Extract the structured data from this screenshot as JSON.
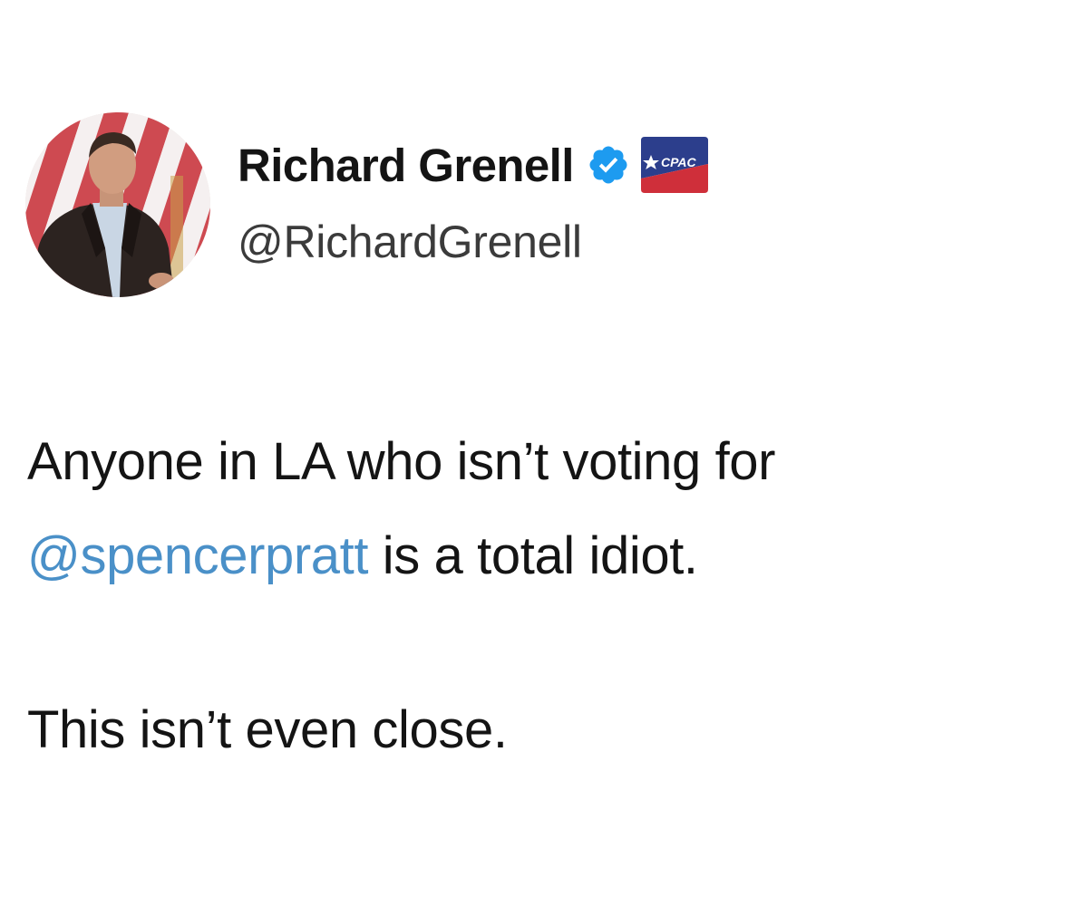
{
  "author": {
    "display_name": "Richard Grenell",
    "handle": "@RichardGrenell",
    "avatar_icon": "profile-photo",
    "verified_icon": "blue-verified-badge-icon",
    "verified_color": "#1d9bf0",
    "affiliation_badge_icon": "cpac-affiliation-badge",
    "affiliation_badge_text": "CPAC"
  },
  "tweet": {
    "line1": "Anyone in LA who isn’t voting for",
    "mention": "@spencerpratt",
    "line2_rest": " is a total idiot.",
    "paragraph2": "This isn’t even close.",
    "mention_color": "#4a90c8"
  }
}
